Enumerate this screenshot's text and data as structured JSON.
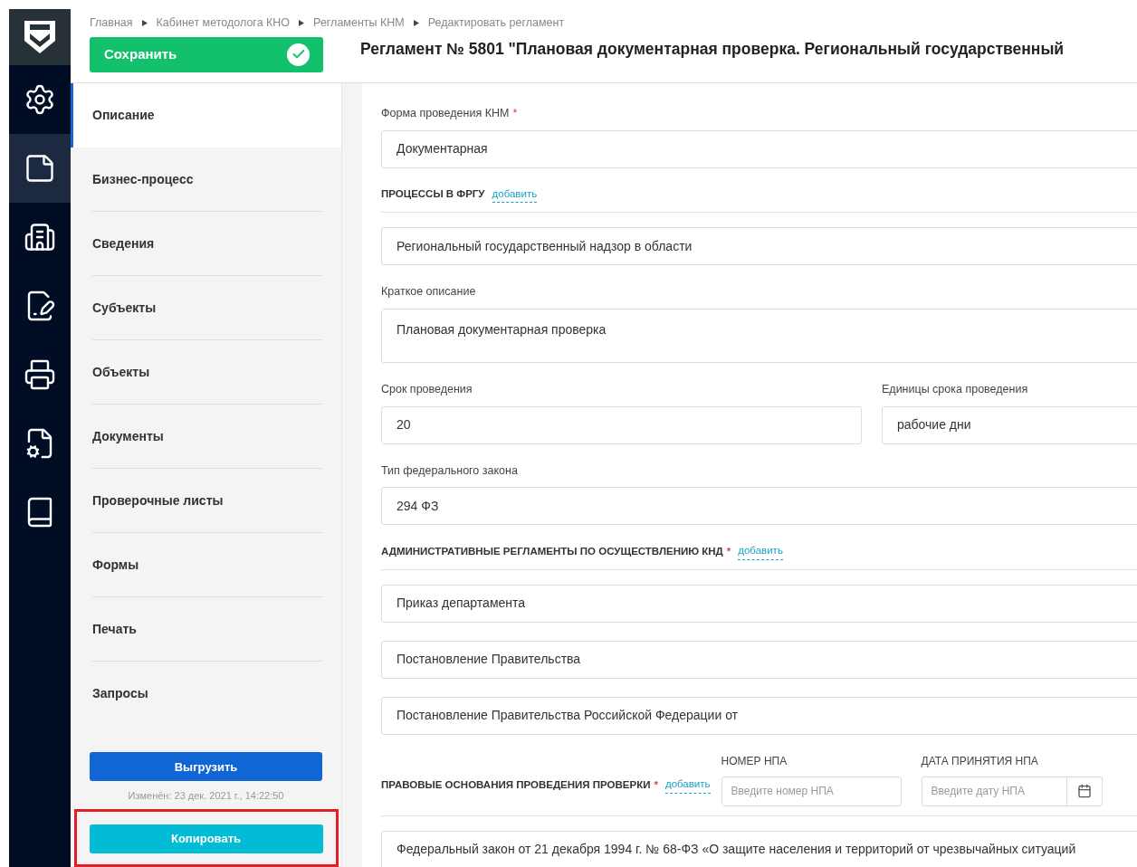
{
  "breadcrumbs": [
    "Главная",
    "Кабинет методолога КНО",
    "Регламенты КНМ",
    "Редактировать регламент"
  ],
  "save_button": "Сохранить",
  "title": "Регламент № 5801 \"Плановая документарная проверка. Региональный государственный",
  "rail": [
    {
      "kind": "gear",
      "selected": false
    },
    {
      "kind": "note",
      "selected": true
    },
    {
      "kind": "building",
      "selected": false
    },
    {
      "kind": "checklist",
      "selected": false
    },
    {
      "kind": "printer",
      "selected": false
    },
    {
      "kind": "book-gear",
      "selected": false
    },
    {
      "kind": "book",
      "selected": false
    }
  ],
  "nav": [
    {
      "label": "Описание",
      "selected": true
    },
    {
      "label": "Бизнес-процесс",
      "selected": false
    },
    {
      "label": "Сведения",
      "selected": false
    },
    {
      "label": "Субъекты",
      "selected": false
    },
    {
      "label": "Объекты",
      "selected": false
    },
    {
      "label": "Документы",
      "selected": false
    },
    {
      "label": "Проверочные листы",
      "selected": false
    },
    {
      "label": "Формы",
      "selected": false
    },
    {
      "label": "Печать",
      "selected": false
    },
    {
      "label": "Запросы",
      "selected": false
    }
  ],
  "export_button": "Выгрузить",
  "modified": "Изменён: 23 дек. 2021 г., 14:22:50",
  "copy_button": "Копировать",
  "copy_highlighted": true,
  "required_mark": "*",
  "form": [
    {
      "kind": "field",
      "label": "Форма проведения КНМ",
      "required": true,
      "values": [
        "Документарная"
      ]
    },
    {
      "kind": "section",
      "heading": "ПРОЦЕССЫ В ФРГУ",
      "required": false,
      "add": "добавить",
      "values": [
        "Региональный государственный надзор в области"
      ]
    },
    {
      "kind": "textarea",
      "label": "Краткое описание",
      "required": false,
      "value": "Плановая документарная проверка"
    },
    {
      "kind": "pair",
      "fields": [
        {
          "label": "Срок проведения",
          "value": "20"
        },
        {
          "label": "Единицы срока проведения",
          "value": "рабочие дни"
        }
      ]
    },
    {
      "kind": "field",
      "label": "Тип федерального закона",
      "required": false,
      "values": [
        "294 ФЗ"
      ]
    },
    {
      "kind": "section",
      "heading": "АДМИНИСТРАТИВНЫЕ РЕГЛАМЕНТЫ ПО ОСУЩЕСТВЛЕНИЮ КНД",
      "required": true,
      "add": "добавить",
      "values": [
        "Приказ департамента",
        "Постановление Правительства",
        "Постановление Правительства Российской Федерации от"
      ]
    },
    {
      "kind": "legal",
      "heading": "ПРАВОВЫЕ ОСНОВАНИЯ ПРОВЕДЕНИЯ ПРОВЕРКИ",
      "required": true,
      "add": "добавить",
      "number_label": "НОМЕР НПА",
      "number_placeholder": "Введите номер НПА",
      "date_label": "ДАТА ПРИНЯТИЯ НПА",
      "date_placeholder": "Введите дату НПА",
      "values": [
        "Федеральный закон от 21 декабря 1994 г. № 68-ФЗ «О защите населения и территорий от чрезвычайных ситуаций"
      ]
    }
  ]
}
